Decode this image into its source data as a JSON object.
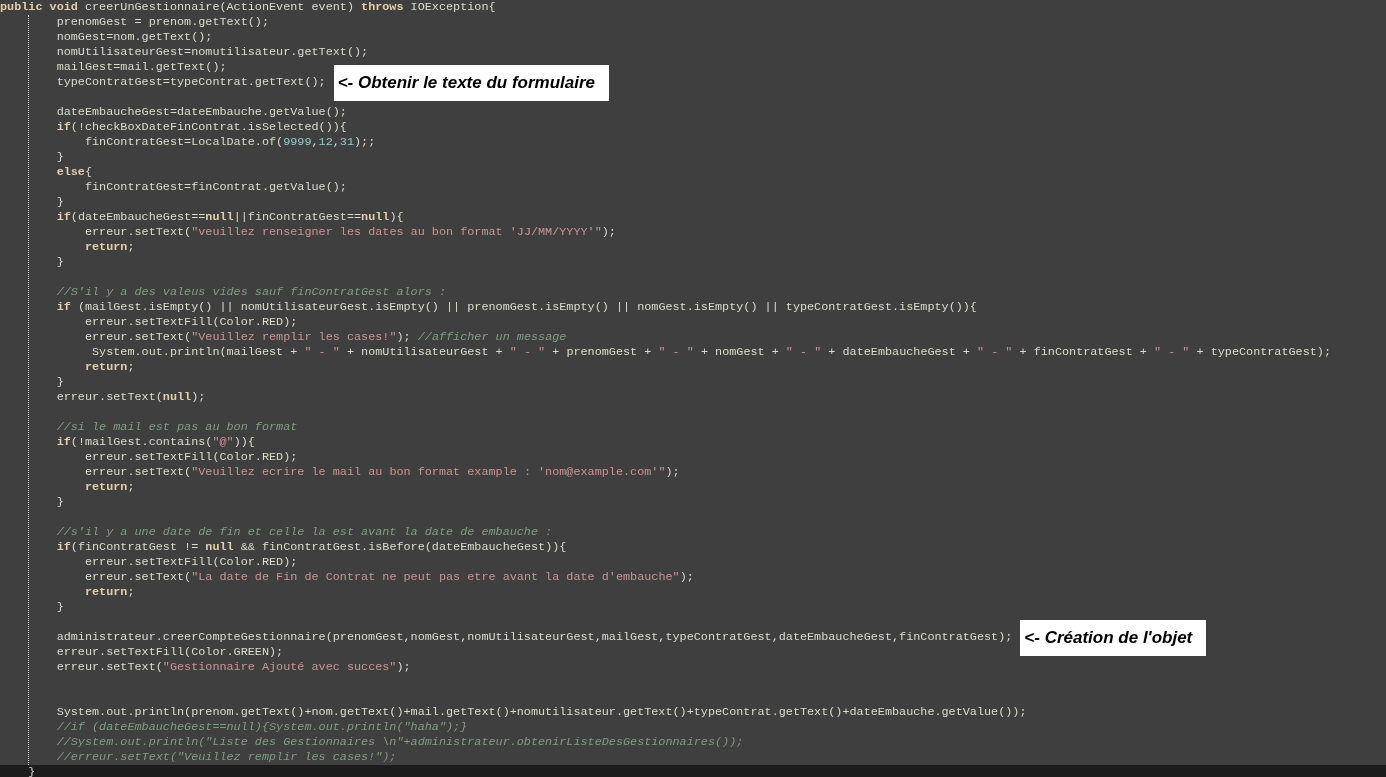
{
  "editor": {
    "lines": [
      {
        "current": false,
        "tokens": [
          {
            "kind": "keyword",
            "text": "public void"
          },
          {
            "kind": "plain",
            "text": " creerUnGestionnaire(ActionEvent event) "
          },
          {
            "kind": "keyword",
            "text": "throws"
          },
          {
            "kind": "plain",
            "text": " IOException{"
          }
        ]
      },
      {
        "current": false,
        "tokens": [
          {
            "kind": "plain",
            "text": "        prenomGest = prenom.getText();"
          }
        ]
      },
      {
        "current": false,
        "tokens": [
          {
            "kind": "plain",
            "text": "        nomGest=nom.getText();"
          }
        ]
      },
      {
        "current": false,
        "tokens": [
          {
            "kind": "plain",
            "text": "        nomUtilisateurGest=nomutilisateur.getText();"
          }
        ]
      },
      {
        "current": false,
        "tokens": [
          {
            "kind": "plain",
            "text": "        mailGest=mail.getText();"
          }
        ]
      },
      {
        "current": false,
        "tokens": [
          {
            "kind": "plain",
            "text": "        typeContratGest=typeContrat.getText();"
          }
        ],
        "note": "<- Obtenir le texte du formulaire"
      },
      {
        "current": false
      },
      {
        "current": false,
        "tokens": [
          {
            "kind": "plain",
            "text": "        dateEmbaucheGest=dateEmbauche.getValue();"
          }
        ]
      },
      {
        "current": false,
        "tokens": [
          {
            "kind": "keyword",
            "text": "        if"
          },
          {
            "kind": "plain",
            "text": "(!checkBoxDateFinContrat.isSelected()){"
          }
        ]
      },
      {
        "current": false,
        "tokens": [
          {
            "kind": "plain",
            "text": "            finContratGest=LocalDate.of("
          },
          {
            "kind": "number",
            "text": "9999"
          },
          {
            "kind": "plain",
            "text": ","
          },
          {
            "kind": "number",
            "text": "12"
          },
          {
            "kind": "plain",
            "text": ","
          },
          {
            "kind": "number",
            "text": "31"
          },
          {
            "kind": "plain",
            "text": ");;"
          }
        ]
      },
      {
        "current": false,
        "tokens": [
          {
            "kind": "plain",
            "text": "        }"
          }
        ]
      },
      {
        "current": false,
        "tokens": [
          {
            "kind": "keyword",
            "text": "        else"
          },
          {
            "kind": "plain",
            "text": "{"
          }
        ]
      },
      {
        "current": false,
        "tokens": [
          {
            "kind": "plain",
            "text": "            finContratGest=finContrat.getValue();"
          }
        ]
      },
      {
        "current": false,
        "tokens": [
          {
            "kind": "plain",
            "text": "        }"
          }
        ]
      },
      {
        "current": false,
        "tokens": [
          {
            "kind": "keyword",
            "text": "        if"
          },
          {
            "kind": "plain",
            "text": "(dateEmbaucheGest=="
          },
          {
            "kind": "keyword",
            "text": "null"
          },
          {
            "kind": "plain",
            "text": "||finContratGest=="
          },
          {
            "kind": "keyword",
            "text": "null"
          },
          {
            "kind": "plain",
            "text": "){"
          }
        ]
      },
      {
        "current": false,
        "tokens": [
          {
            "kind": "plain",
            "text": "            erreur.setText("
          },
          {
            "kind": "string",
            "text": "\"veuillez renseigner les dates au bon format 'JJ/MM/YYYY'\""
          },
          {
            "kind": "plain",
            "text": ");"
          }
        ]
      },
      {
        "current": false,
        "tokens": [
          {
            "kind": "keyword",
            "text": "            return"
          },
          {
            "kind": "plain",
            "text": ";"
          }
        ]
      },
      {
        "current": false,
        "tokens": [
          {
            "kind": "plain",
            "text": "        }"
          }
        ]
      },
      {
        "current": false
      },
      {
        "current": false,
        "tokens": [
          {
            "kind": "comment",
            "text": "        //S'il y a des valeus vides sauf finContratGest alors :"
          }
        ]
      },
      {
        "current": false,
        "tokens": [
          {
            "kind": "keyword",
            "text": "        if"
          },
          {
            "kind": "plain",
            "text": " (mailGest.isEmpty() || nomUtilisateurGest.isEmpty() || prenomGest.isEmpty() || nomGest.isEmpty() || typeContratGest.isEmpty()){"
          }
        ]
      },
      {
        "current": false,
        "tokens": [
          {
            "kind": "plain",
            "text": "            erreur.setTextFill(Color.RED);"
          }
        ]
      },
      {
        "current": false,
        "tokens": [
          {
            "kind": "plain",
            "text": "            erreur.setText("
          },
          {
            "kind": "string",
            "text": "\"Veuillez remplir les cases!\""
          },
          {
            "kind": "plain",
            "text": "); "
          },
          {
            "kind": "comment",
            "text": "//afficher un message"
          }
        ]
      },
      {
        "current": false,
        "tokens": [
          {
            "kind": "plain",
            "text": "             System.out.println(mailGest + "
          },
          {
            "kind": "string",
            "text": "\" - \""
          },
          {
            "kind": "plain",
            "text": " + nomUtilisateurGest + "
          },
          {
            "kind": "string",
            "text": "\" - \""
          },
          {
            "kind": "plain",
            "text": " + prenomGest + "
          },
          {
            "kind": "string",
            "text": "\" - \""
          },
          {
            "kind": "plain",
            "text": " + nomGest + "
          },
          {
            "kind": "string",
            "text": "\" - \""
          },
          {
            "kind": "plain",
            "text": " + dateEmbaucheGest + "
          },
          {
            "kind": "string",
            "text": "\" - \""
          },
          {
            "kind": "plain",
            "text": " + finContratGest + "
          },
          {
            "kind": "string",
            "text": "\" - \""
          },
          {
            "kind": "plain",
            "text": " + typeContratGest);"
          }
        ]
      },
      {
        "current": false,
        "tokens": [
          {
            "kind": "keyword",
            "text": "            return"
          },
          {
            "kind": "plain",
            "text": ";"
          }
        ]
      },
      {
        "current": false,
        "tokens": [
          {
            "kind": "plain",
            "text": "        }"
          }
        ]
      },
      {
        "current": false,
        "tokens": [
          {
            "kind": "plain",
            "text": "        erreur.setText("
          },
          {
            "kind": "keyword",
            "text": "null"
          },
          {
            "kind": "plain",
            "text": ");"
          }
        ]
      },
      {
        "current": false
      },
      {
        "current": false,
        "tokens": [
          {
            "kind": "comment",
            "text": "        //si le mail est pas au bon format"
          }
        ]
      },
      {
        "current": false,
        "tokens": [
          {
            "kind": "keyword",
            "text": "        if"
          },
          {
            "kind": "plain",
            "text": "(!mailGest.contains("
          },
          {
            "kind": "string",
            "text": "\"@\""
          },
          {
            "kind": "plain",
            "text": ")){"
          }
        ]
      },
      {
        "current": false,
        "tokens": [
          {
            "kind": "plain",
            "text": "            erreur.setTextFill(Color.RED);"
          }
        ]
      },
      {
        "current": false,
        "tokens": [
          {
            "kind": "plain",
            "text": "            erreur.setText("
          },
          {
            "kind": "string",
            "text": "\"Veuillez ecrire le mail au bon format example : 'nom@example.com'\""
          },
          {
            "kind": "plain",
            "text": ");"
          }
        ]
      },
      {
        "current": false,
        "tokens": [
          {
            "kind": "keyword",
            "text": "            return"
          },
          {
            "kind": "plain",
            "text": ";"
          }
        ]
      },
      {
        "current": false,
        "tokens": [
          {
            "kind": "plain",
            "text": "        }"
          }
        ]
      },
      {
        "current": false
      },
      {
        "current": false,
        "tokens": [
          {
            "kind": "comment",
            "text": "        //s'il y a une date de fin et celle la est avant la date de embauche :"
          }
        ]
      },
      {
        "current": false,
        "tokens": [
          {
            "kind": "keyword",
            "text": "        if"
          },
          {
            "kind": "plain",
            "text": "(finContratGest != "
          },
          {
            "kind": "keyword",
            "text": "null"
          },
          {
            "kind": "plain",
            "text": " && finContratGest.isBefore(dateEmbaucheGest)){"
          }
        ]
      },
      {
        "current": false,
        "tokens": [
          {
            "kind": "plain",
            "text": "            erreur.setTextFill(Color.RED);"
          }
        ]
      },
      {
        "current": false,
        "tokens": [
          {
            "kind": "plain",
            "text": "            erreur.setText("
          },
          {
            "kind": "string",
            "text": "\"La date de Fin de Contrat ne peut pas etre avant la date d'embauche\""
          },
          {
            "kind": "plain",
            "text": ");"
          }
        ]
      },
      {
        "current": false,
        "tokens": [
          {
            "kind": "keyword",
            "text": "            return"
          },
          {
            "kind": "plain",
            "text": ";"
          }
        ]
      },
      {
        "current": false,
        "tokens": [
          {
            "kind": "plain",
            "text": "        }"
          }
        ]
      },
      {
        "current": false
      },
      {
        "current": false,
        "tokens": [
          {
            "kind": "plain",
            "text": "        administrateur.creerCompteGestionnaire(prenomGest,nomGest,nomUtilisateurGest,mailGest,typeContratGest,dateEmbaucheGest,finContratGest);"
          }
        ],
        "note": "<- Création de l'objet"
      },
      {
        "current": false,
        "tokens": [
          {
            "kind": "plain",
            "text": "        erreur.setTextFill(Color.GREEN);"
          }
        ]
      },
      {
        "current": false,
        "tokens": [
          {
            "kind": "plain",
            "text": "        erreur.setText("
          },
          {
            "kind": "string",
            "text": "\"Gestionnaire Ajouté avec succes\""
          },
          {
            "kind": "plain",
            "text": ");"
          }
        ]
      },
      {
        "current": false
      },
      {
        "current": false
      },
      {
        "current": false,
        "tokens": [
          {
            "kind": "plain",
            "text": "        System.out.println(prenom.getText()+nom.getText()+mail.getText()+nomutilisateur.getText()+typeContrat.getText()+dateEmbauche.getValue());"
          }
        ]
      },
      {
        "current": false,
        "tokens": [
          {
            "kind": "comment",
            "text": "        //if (dateEmbaucheGest==null){System.out.println(\"haha\");}"
          }
        ]
      },
      {
        "current": false,
        "tokens": [
          {
            "kind": "comment",
            "text": "        //System.out.println(\"Liste des Gestionnaires \\n\"+administrateur.obtenirListeDesGestionnaires());"
          }
        ]
      },
      {
        "current": false,
        "tokens": [
          {
            "kind": "comment",
            "text": "        //erreur.setText(\"Veuillez remplir les cases!\");"
          }
        ]
      },
      {
        "current": true,
        "tokens": [
          {
            "kind": "plain",
            "text": "    }"
          }
        ]
      }
    ]
  }
}
